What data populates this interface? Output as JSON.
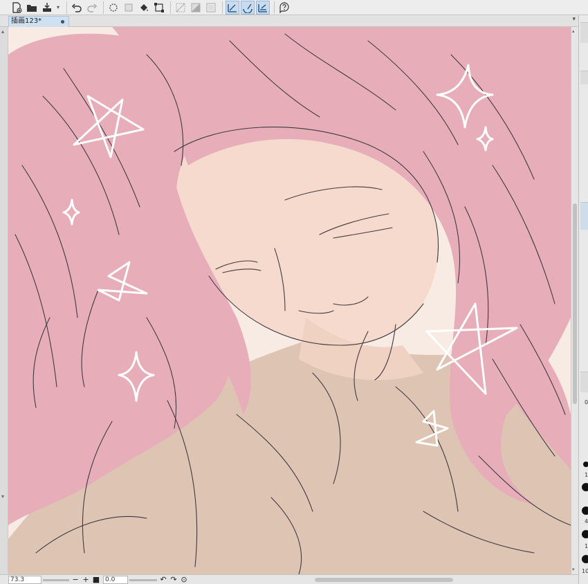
{
  "toolbar": {
    "buttons": [
      {
        "name": "new-file-icon"
      },
      {
        "name": "open-folder-icon"
      },
      {
        "name": "save-icon"
      },
      {
        "name": "undo-icon"
      },
      {
        "name": "redo-icon"
      },
      {
        "name": "clear-selection-icon"
      },
      {
        "name": "crop-icon"
      },
      {
        "name": "fill-icon"
      },
      {
        "name": "transform-icon"
      },
      {
        "name": "hide-selection-icon"
      },
      {
        "name": "select-all-icon"
      },
      {
        "name": "invert-selection-icon"
      },
      {
        "name": "ruler-snap-icon"
      },
      {
        "name": "special-ruler-snap-icon"
      },
      {
        "name": "grid-snap-icon"
      },
      {
        "name": "help-icon"
      }
    ]
  },
  "document": {
    "tab_title": "插画123*"
  },
  "status": {
    "zoom": "73.3",
    "zoom_out": "−",
    "zoom_in": "+",
    "angle": "0.0"
  },
  "right_panel": {
    "labels": [
      "0",
      "1",
      "4",
      "1",
      "10"
    ]
  },
  "colors": {
    "hair": "#e7aeba",
    "skin": "#f5dacd",
    "shirt": "#ddc4b3",
    "background": "#f7ebe4",
    "lineart": "#3f3a40",
    "sparkle": "#ffffff"
  }
}
